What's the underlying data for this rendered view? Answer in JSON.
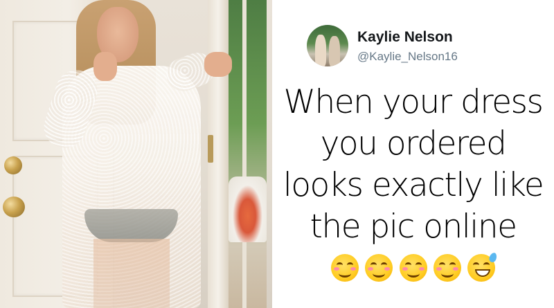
{
  "tweet": {
    "author_name": "Kaylie Nelson",
    "author_handle": "@Kaylie_Nelson16",
    "lines": [
      "When your dress",
      "you ordered",
      "looks exactly like",
      "the pic online"
    ],
    "emojis": [
      "smiling-face-with-smiling-eyes-icon",
      "smiling-face-with-smiling-eyes-icon",
      "smiling-face-with-smiling-eyes-icon",
      "smiling-face-with-smiling-eyes-icon",
      "grinning-face-with-sweat-icon"
    ]
  },
  "colors": {
    "name": "#14171a",
    "handle": "#657786",
    "text": "#000000"
  }
}
